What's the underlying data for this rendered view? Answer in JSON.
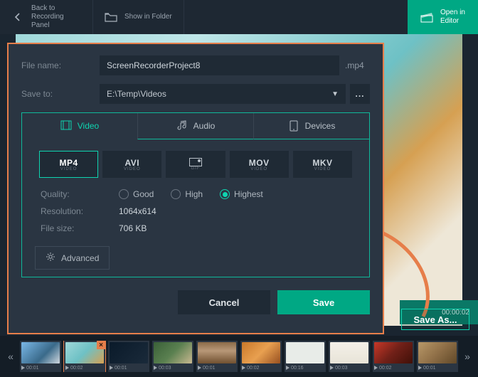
{
  "topbar": {
    "back": {
      "line1": "Back to",
      "line2": "Recording Panel"
    },
    "show_folder": "Show in Folder",
    "open_editor": {
      "line1": "Open in",
      "line2": "Editor"
    }
  },
  "dialog": {
    "file_name_label": "File name:",
    "file_name_value": "ScreenRecorderProject8",
    "file_ext": ".mp4",
    "save_to_label": "Save to:",
    "save_to_value": "E:\\Temp\\Videos",
    "browse_label": "...",
    "tabs": {
      "video": "Video",
      "audio": "Audio",
      "devices": "Devices"
    },
    "formats": {
      "mp4": "MP4",
      "avi": "AVI",
      "gif": "GIF",
      "mov": "MOV",
      "mkv": "MKV",
      "sub": "VIDEO"
    },
    "quality_label": "Quality:",
    "quality": {
      "good": "Good",
      "high": "High",
      "highest": "Highest",
      "selected": "highest"
    },
    "resolution_label": "Resolution:",
    "resolution_value": "1064x614",
    "filesize_label": "File size:",
    "filesize_value": "706 KB",
    "advanced": "Advanced",
    "cancel": "Cancel",
    "save": "Save"
  },
  "side": {
    "duration": "00:00:02",
    "save_as": "Save As..."
  },
  "filmstrip": {
    "items": [
      {
        "time": "00:01",
        "cls": "c-photo1"
      },
      {
        "time": "00:02",
        "cls": "c-photo2",
        "selected": true
      },
      {
        "time": "00:01",
        "cls": "c-photo3"
      },
      {
        "time": "00:03",
        "cls": "c-photo4"
      },
      {
        "time": "00:01",
        "cls": "c-photo5"
      },
      {
        "time": "00:02",
        "cls": "c-photo6"
      },
      {
        "time": "00:16",
        "cls": "c-photo7"
      },
      {
        "time": "00:03",
        "cls": "c-photo8"
      },
      {
        "time": "00:02",
        "cls": "c-photo9"
      },
      {
        "time": "00:01",
        "cls": "c-photo10"
      }
    ]
  },
  "colors": {
    "accent_green": "#00a884",
    "accent_orange": "#e67e4a"
  }
}
